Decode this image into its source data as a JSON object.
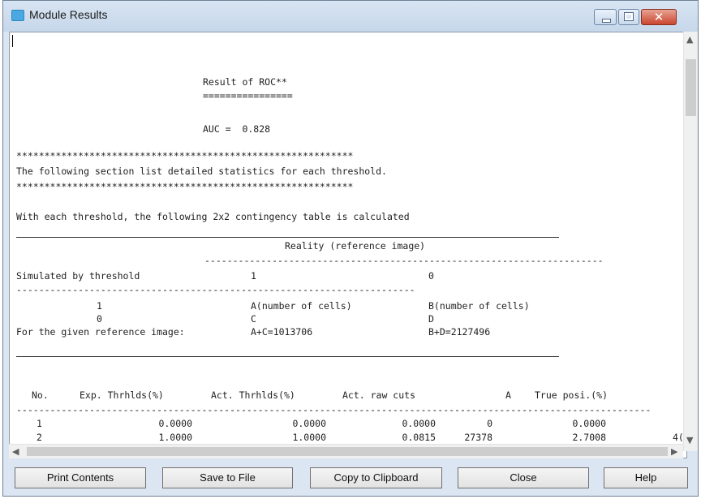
{
  "window": {
    "title": "Module Results"
  },
  "report": {
    "result_title": "Result of ROC**",
    "result_underline": "================",
    "auc_line": "AUC =  0.828",
    "stars_top": "************************************************************",
    "section_desc": "The following section list detailed statistics for each threshold.",
    "stars_bottom": "************************************************************",
    "contingency_intro": "With each threshold, the following 2x2 contingency table is calculated",
    "contingency": {
      "reality_header": "Reality (reference image)",
      "dashes": "-----------------------------------------------------------------------",
      "simulated_label": "Simulated by threshold",
      "col_1": "1",
      "col_0": "0",
      "row_1": "1",
      "row_0": "0",
      "cell_a": "A(number of cells)",
      "cell_b": "B(number of cells)",
      "cell_c": "C",
      "cell_d": "D",
      "given_ref_label": "For the given reference image:",
      "a_plus_c": "A+C=1013706",
      "b_plus_d": "B+D=2127496"
    },
    "table": {
      "headers": [
        "No.",
        "Exp. Thrhlds(%)",
        "Act. Thrhlds(%)",
        "Act. raw cuts",
        "A",
        "True posi.(%)"
      ],
      "dashes": "-----------------------------------------------------------------------------------------------------------------",
      "rows": [
        [
          "1",
          "0.0000",
          "0.0000",
          "0.0000",
          "0",
          "0.0000",
          ""
        ],
        [
          "2",
          "1.0000",
          "1.0000",
          "0.0815",
          "27378",
          "2.7008",
          "4("
        ]
      ]
    }
  },
  "buttons": {
    "print": "Print Contents",
    "save": "Save to File",
    "copy": "Copy to Clipboard",
    "close": "Close",
    "help": "Help"
  }
}
